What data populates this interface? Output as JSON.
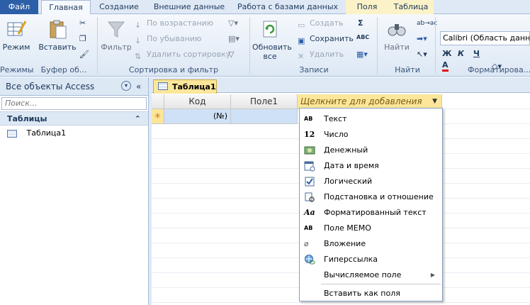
{
  "tabs": [
    "Файл",
    "Главная",
    "Создание",
    "Внешние данные",
    "Работа с базами данных",
    "Поля",
    "Таблица"
  ],
  "ribbon": {
    "groups": {
      "views": "Режимы",
      "clipboard": "Буфер об...",
      "sort_filter": "Сортировка и фильтр",
      "records": "Записи",
      "find": "Найти",
      "formatting": "Форматирова..."
    },
    "mode_btn": "Режим",
    "paste_btn": "Вставить",
    "filter_btn": "Фильтр",
    "sort_asc": "По возрастанию",
    "sort_desc": "По убыванию",
    "remove_sort": "Удалить сортировку",
    "refresh_btn": "Обновить все",
    "create": "Создать",
    "save": "Сохранить",
    "delete": "Удалить",
    "find_btn": "Найти",
    "font_name": "Calibri (Область данны"
  },
  "nav": {
    "title": "Все объекты Access",
    "search_placeholder": "Поиск...",
    "section": "Таблицы",
    "items": [
      "Таблица1"
    ]
  },
  "doc": {
    "tab": "Таблица1",
    "columns": [
      "Код",
      "Поле1",
      "Щелкните для добавления"
    ],
    "new_row_marker": "✳",
    "id_cell": "(№)"
  },
  "menu": {
    "items": [
      "Текст",
      "Число",
      "Денежный",
      "Дата и время",
      "Логический",
      "Подстановка и отношение",
      "Форматированный текст",
      "Поле МЕМО",
      "Вложение",
      "Гиперссылка",
      "Вычисляемое поле"
    ],
    "paste_as": "Вставить как поля"
  },
  "colors": {
    "accent": "#2d5fa8",
    "header_band": "#dde8f5",
    "selected_cell": "#cfe1f6"
  }
}
